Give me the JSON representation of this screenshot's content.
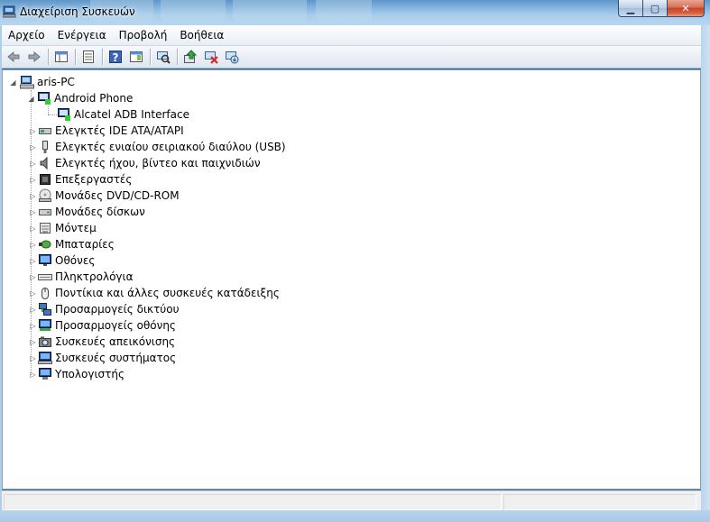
{
  "window": {
    "title": "Διαχείριση Συσκευών",
    "min_icon": "minimize-icon",
    "max_icon": "maximize-icon",
    "close_icon": "close-icon"
  },
  "menu": [
    "Αρχείο",
    "Ενέργεια",
    "Προβολή",
    "Βοήθεια"
  ],
  "toolbar": {
    "buttons": [
      "back-icon",
      "forward-icon",
      "console-tree-icon",
      "properties-icon",
      "help-icon",
      "show-hide-action-pane-icon",
      "scan-hardware-icon",
      "update-driver-icon",
      "disable-device-icon",
      "uninstall-device-icon"
    ]
  },
  "tree": {
    "root": "aris-PC",
    "android_phone": "Android Phone",
    "android_child": "Alcatel ADB Interface",
    "categories": [
      "Ελεγκτές IDE ATA/ATAPI",
      "Ελεγκτές ενιαίου σειριακού διαύλου (USB)",
      "Ελεγκτές ήχου, βίντεο και παιχνιδιών",
      "Επεξεργαστές",
      "Μονάδες DVD/CD-ROM",
      "Μονάδες δίσκων",
      "Μόντεμ",
      "Μπαταρίες",
      "Οθόνες",
      "Πληκτρολόγια",
      "Ποντίκια και άλλες συσκευές κατάδειξης",
      "Προσαρμογείς δικτύου",
      "Προσαρμογείς οθόνης",
      "Συσκευές απεικόνισης",
      "Συσκευές συστήματος",
      "Υπολογιστής"
    ]
  }
}
